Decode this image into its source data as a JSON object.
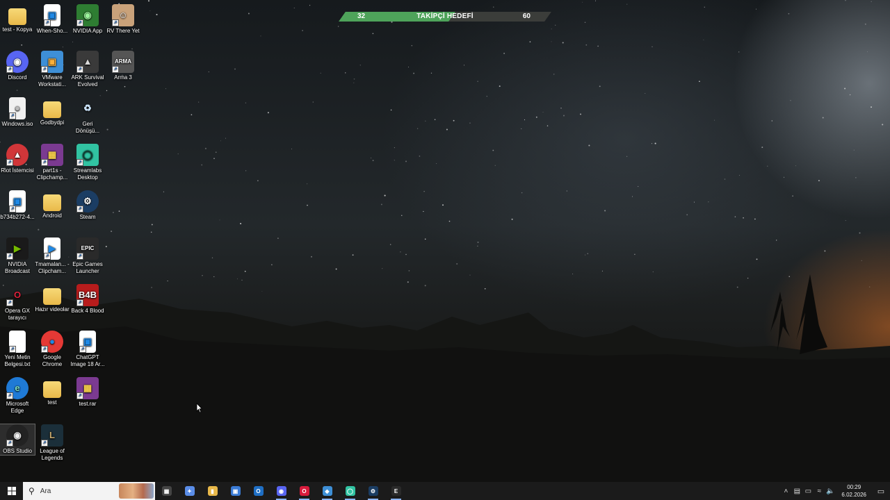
{
  "desktop": {
    "icons": [
      {
        "label": "test - Kopya",
        "kind": "folder",
        "col": 0,
        "row": 0
      },
      {
        "label": "When-Sho...",
        "kind": "image",
        "col": 1,
        "row": 0
      },
      {
        "label": "NVIDIA App",
        "kind": "nvidia",
        "col": 2,
        "row": 0
      },
      {
        "label": "RV There Yet",
        "kind": "rv",
        "col": 3,
        "row": 0
      },
      {
        "label": "Discord",
        "kind": "discord",
        "col": 0,
        "row": 1
      },
      {
        "label": "VMware Workstati...",
        "kind": "vmware",
        "col": 1,
        "row": 1
      },
      {
        "label": "ARK Survival Evolved",
        "kind": "ark",
        "col": 2,
        "row": 1
      },
      {
        "label": "Arma 3",
        "kind": "arma",
        "col": 3,
        "row": 1
      },
      {
        "label": "Windows.iso",
        "kind": "iso",
        "col": 0,
        "row": 2
      },
      {
        "label": "Godbydpi",
        "kind": "folder",
        "col": 1,
        "row": 2
      },
      {
        "label": "Geri Dönüşü...",
        "kind": "recycle",
        "col": 2,
        "row": 2
      },
      {
        "label": "Riot İstemcisi",
        "kind": "riot",
        "col": 0,
        "row": 3
      },
      {
        "label": "part1s - Clipchamp...",
        "kind": "winrar",
        "col": 1,
        "row": 3
      },
      {
        "label": "Streamlabs Desktop",
        "kind": "streamlabs",
        "col": 2,
        "row": 3
      },
      {
        "label": "b734b272-4...",
        "kind": "image",
        "col": 0,
        "row": 4
      },
      {
        "label": "Android",
        "kind": "folder",
        "col": 1,
        "row": 4
      },
      {
        "label": "Steam",
        "kind": "steam",
        "col": 2,
        "row": 4
      },
      {
        "label": "NVIDIA Broadcast",
        "kind": "broadcast",
        "col": 0,
        "row": 5
      },
      {
        "label": "Tmamalan... - Clipcham...",
        "kind": "video",
        "col": 1,
        "row": 5
      },
      {
        "label": "Epic Games Launcher",
        "kind": "epic",
        "col": 2,
        "row": 5
      },
      {
        "label": "Opera GX tarayıcı",
        "kind": "opera",
        "col": 0,
        "row": 6
      },
      {
        "label": "Hazır videolar",
        "kind": "folder",
        "col": 1,
        "row": 6
      },
      {
        "label": "Back 4 Blood",
        "kind": "b4b",
        "col": 2,
        "row": 6
      },
      {
        "label": "Yeni Metin Belgesi.txt",
        "kind": "txt",
        "col": 0,
        "row": 7
      },
      {
        "label": "Google Chrome",
        "kind": "chrome",
        "col": 1,
        "row": 7
      },
      {
        "label": "ChatGPT Image 18 Ar...",
        "kind": "image",
        "col": 2,
        "row": 7
      },
      {
        "label": "Microsoft Edge",
        "kind": "edge",
        "col": 0,
        "row": 8
      },
      {
        "label": "test",
        "kind": "folder",
        "col": 1,
        "row": 8
      },
      {
        "label": "test.rar",
        "kind": "winrar",
        "col": 2,
        "row": 8
      },
      {
        "label": "OBS Studio",
        "kind": "obs",
        "col": 0,
        "row": 9,
        "selected": true
      },
      {
        "label": "League of Legends",
        "kind": "lol",
        "col": 1,
        "row": 9
      }
    ]
  },
  "follower_goal": {
    "current": "32",
    "title": "TAKİPÇİ HEDEFİ",
    "target": "60",
    "progress": 0.533
  },
  "taskbar": {
    "search_placeholder": "Ara",
    "pinned": [
      {
        "name": "task-view",
        "color": "#444"
      },
      {
        "name": "copilot",
        "color": "#5a8de8"
      },
      {
        "name": "file-explorer",
        "color": "#e8b84a"
      },
      {
        "name": "microsoft-store",
        "color": "#3a7bd5"
      },
      {
        "name": "outlook",
        "color": "#1f6fc5"
      },
      {
        "name": "discord",
        "color": "#5865f2"
      },
      {
        "name": "opera-gx",
        "color": "#d81b3c"
      },
      {
        "name": "vmware",
        "color": "#3e8fd6"
      },
      {
        "name": "streamlabs",
        "color": "#31c3a2"
      },
      {
        "name": "steam",
        "color": "#1b3d63"
      },
      {
        "name": "epic-games",
        "color": "#2a2a2a"
      }
    ],
    "time": "00:29",
    "date": "6.02.2026"
  }
}
